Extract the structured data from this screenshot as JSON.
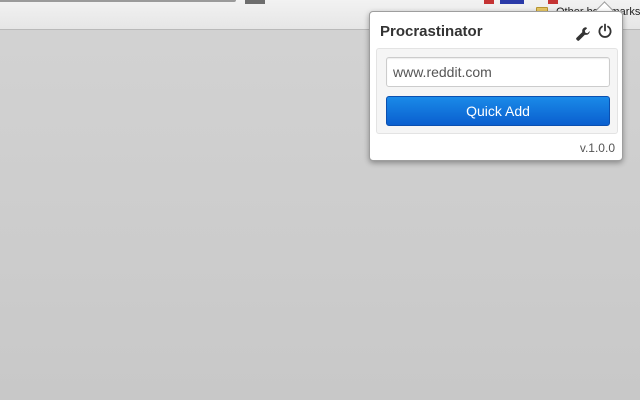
{
  "browser": {
    "bookmark_text": "Other bookmarks"
  },
  "popup": {
    "title": "Procrastinator",
    "url_value": "www.reddit.com",
    "quick_add_label": "Quick Add",
    "version": "v.1.0.0",
    "icons": [
      "wrench-icon",
      "power-icon"
    ]
  },
  "colors": {
    "button_top": "#1a8ae8",
    "button_bottom": "#0a5fcf",
    "background": "#c8c8c8"
  }
}
